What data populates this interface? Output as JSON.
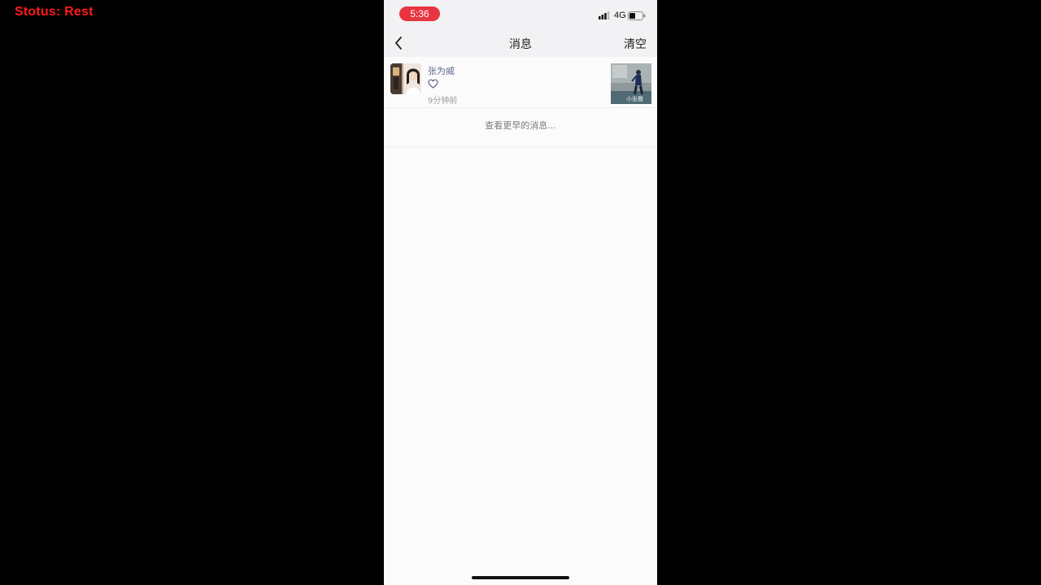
{
  "overlay": {
    "status_text": "Stotus:  Rest"
  },
  "status_bar": {
    "time": "5:36",
    "network": "4G"
  },
  "nav": {
    "title": "消息",
    "clear_label": "清空"
  },
  "messages": [
    {
      "sender": "张为威",
      "action_icon": "heart-outline-icon",
      "time": "9分钟前",
      "thumbnail_caption": "小张撒"
    }
  ],
  "earlier_link": "查看更早的消息...",
  "colors": {
    "time_pill": "#e8353f",
    "sender_name": "#5e6b86",
    "overlay_text": "#ff1a1a"
  }
}
